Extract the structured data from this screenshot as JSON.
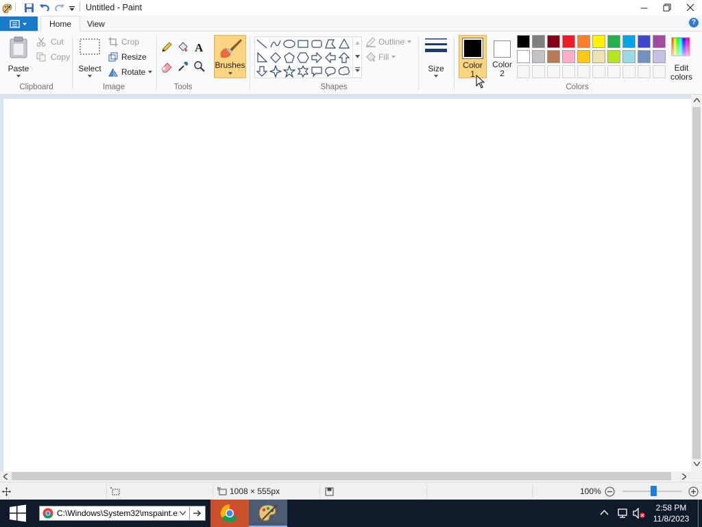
{
  "window": {
    "title": "Untitled - Paint",
    "controls": [
      "minimize",
      "restore",
      "close"
    ]
  },
  "quick_access": {
    "icons": [
      "paint-app-icon",
      "save-icon",
      "undo-icon",
      "redo-icon",
      "customize-dropdown-icon"
    ]
  },
  "ribbon_tabs": [
    {
      "label": "Home",
      "active": true
    },
    {
      "label": "View",
      "active": false
    }
  ],
  "groups": {
    "clipboard": {
      "label": "Clipboard",
      "paste": "Paste",
      "cut": "Cut",
      "copy": "Copy"
    },
    "image": {
      "label": "Image",
      "select": "Select",
      "crop": "Crop",
      "resize": "Resize",
      "rotate": "Rotate"
    },
    "tools": {
      "label": "Tools",
      "icons": [
        "pencil-icon",
        "fill-bucket-icon",
        "text-icon",
        "eraser-icon",
        "color-picker-icon",
        "magnifier-icon"
      ]
    },
    "brushes": {
      "label": "Brushes"
    },
    "shapes": {
      "label": "Shapes",
      "outline": "Outline",
      "fill": "Fill"
    },
    "size": {
      "label": "Size"
    },
    "colors": {
      "label": "Colors",
      "color1_line1": "Color",
      "color1_line2": "1",
      "color2_line1": "Color",
      "color2_line2": "2",
      "edit_line1": "Edit",
      "edit_line2": "colors",
      "color1_value": "#000000",
      "color2_value": "#ffffff",
      "palette_row1": [
        "#000000",
        "#7f7f7f",
        "#880015",
        "#ed1c24",
        "#ff7f27",
        "#fff200",
        "#22b14c",
        "#00a2e8",
        "#3f48cc",
        "#a349a4"
      ],
      "palette_row2": [
        "#ffffff",
        "#c3c3c3",
        "#b97a57",
        "#ffaec9",
        "#ffc90e",
        "#efe4b0",
        "#b5e61d",
        "#99d9ea",
        "#7092be",
        "#c8bfe7"
      ],
      "palette_row3_empty": 10
    }
  },
  "status_bar": {
    "canvas_size": "1008 × 555px",
    "zoom": "100%",
    "zoom_percent": 100
  },
  "taskbar": {
    "address": "C:\\Windows\\System32\\mspaint.exe",
    "clock_time": "2:58 PM",
    "clock_date": "11/8/2023",
    "apps": [
      "chrome-app",
      "paint-app"
    ]
  }
}
